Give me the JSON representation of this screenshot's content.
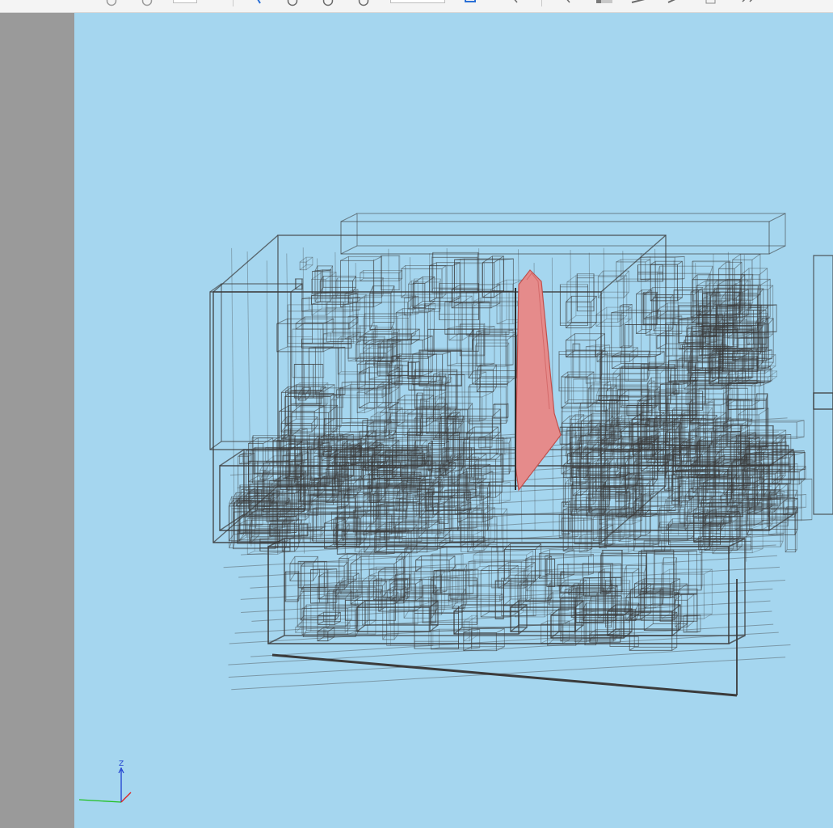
{
  "toolbar": {
    "buttons": [
      {
        "icon": "undo-icon"
      },
      {
        "icon": "redo-icon"
      },
      {
        "icon": "select-icon"
      },
      {
        "icon": "rotate-icon"
      },
      {
        "icon": "zoom-icon"
      },
      {
        "icon": "fit-icon"
      },
      {
        "icon": "view-cube-icon"
      },
      {
        "icon": "pick-icon"
      },
      {
        "icon": "pointer-icon"
      },
      {
        "icon": "section-icon"
      },
      {
        "icon": "measure-icon"
      },
      {
        "icon": "explode-icon"
      },
      {
        "icon": "page-icon"
      },
      {
        "icon": "more-icon"
      }
    ]
  },
  "viewport": {
    "background_color": "#a5d6ef",
    "wire_color": "#3b3b3b",
    "highlight_fill": "#e58b8b",
    "highlight_stroke": "#c0504d"
  },
  "axis_triad": {
    "z_label": "Z",
    "x_color": "#e02020",
    "y_color": "#20c020",
    "z_color": "#2040d0"
  }
}
